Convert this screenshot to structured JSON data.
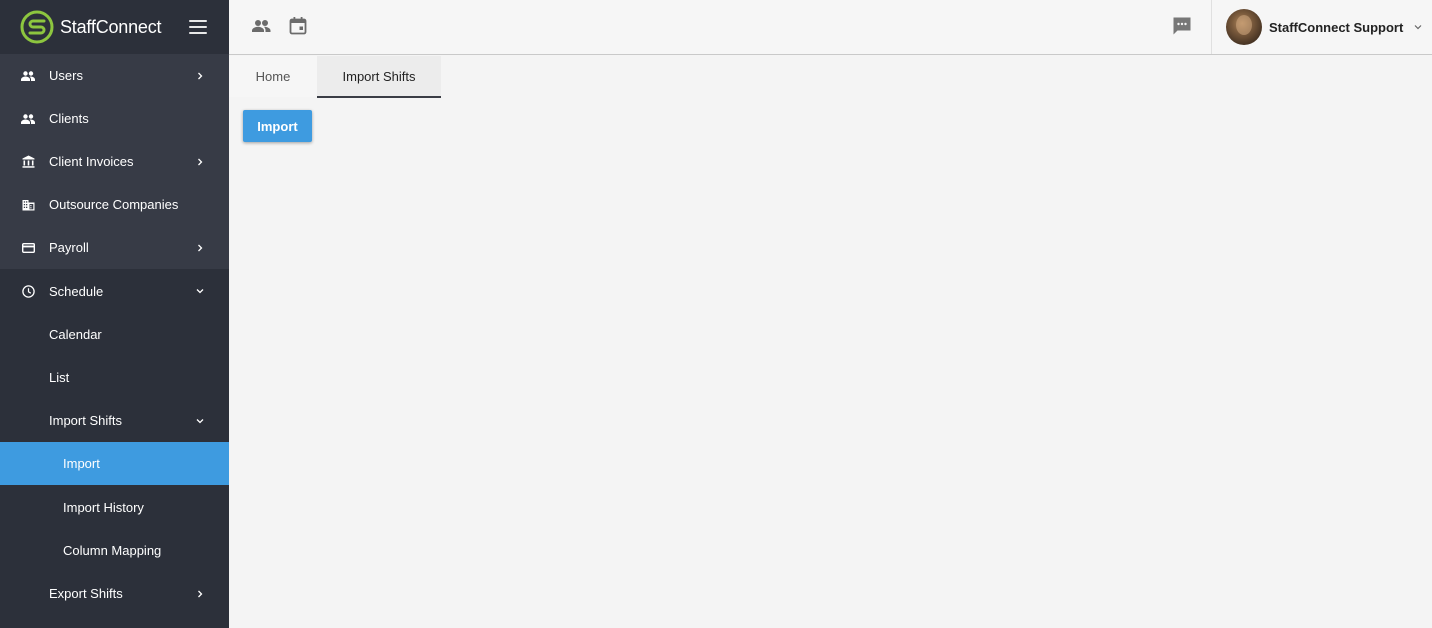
{
  "brand": {
    "name": "StaffConnect"
  },
  "sidebar": {
    "items": [
      {
        "label": "Users",
        "icon": "people-icon",
        "chevron": "right"
      },
      {
        "label": "Clients",
        "icon": "people-icon"
      },
      {
        "label": "Client Invoices",
        "icon": "bank-icon",
        "chevron": "right"
      },
      {
        "label": "Outsource Companies",
        "icon": "building-icon"
      },
      {
        "label": "Payroll",
        "icon": "card-icon",
        "chevron": "right"
      },
      {
        "label": "Schedule",
        "icon": "clock-icon",
        "chevron": "down"
      }
    ],
    "schedule_children": [
      {
        "label": "Calendar"
      },
      {
        "label": "List"
      },
      {
        "label": "Import Shifts",
        "chevron": "down"
      }
    ],
    "import_children": [
      {
        "label": "Import",
        "active": true
      },
      {
        "label": "Import History"
      },
      {
        "label": "Column Mapping"
      }
    ],
    "export": {
      "label": "Export Shifts",
      "chevron": "right"
    }
  },
  "topbar": {
    "icons": [
      "people-icon",
      "calendar-icon",
      "chat-icon"
    ],
    "user_name": "StaffConnect Support"
  },
  "tabs": [
    {
      "label": "Home",
      "active": false
    },
    {
      "label": "Import Shifts",
      "active": true
    }
  ],
  "main": {
    "import_button": "Import"
  },
  "colors": {
    "sidebar_bg": "#2c303a",
    "sidebar_item_bg": "#373b46",
    "accent": "#3e9be0",
    "brand_green": "#8dc63f"
  }
}
